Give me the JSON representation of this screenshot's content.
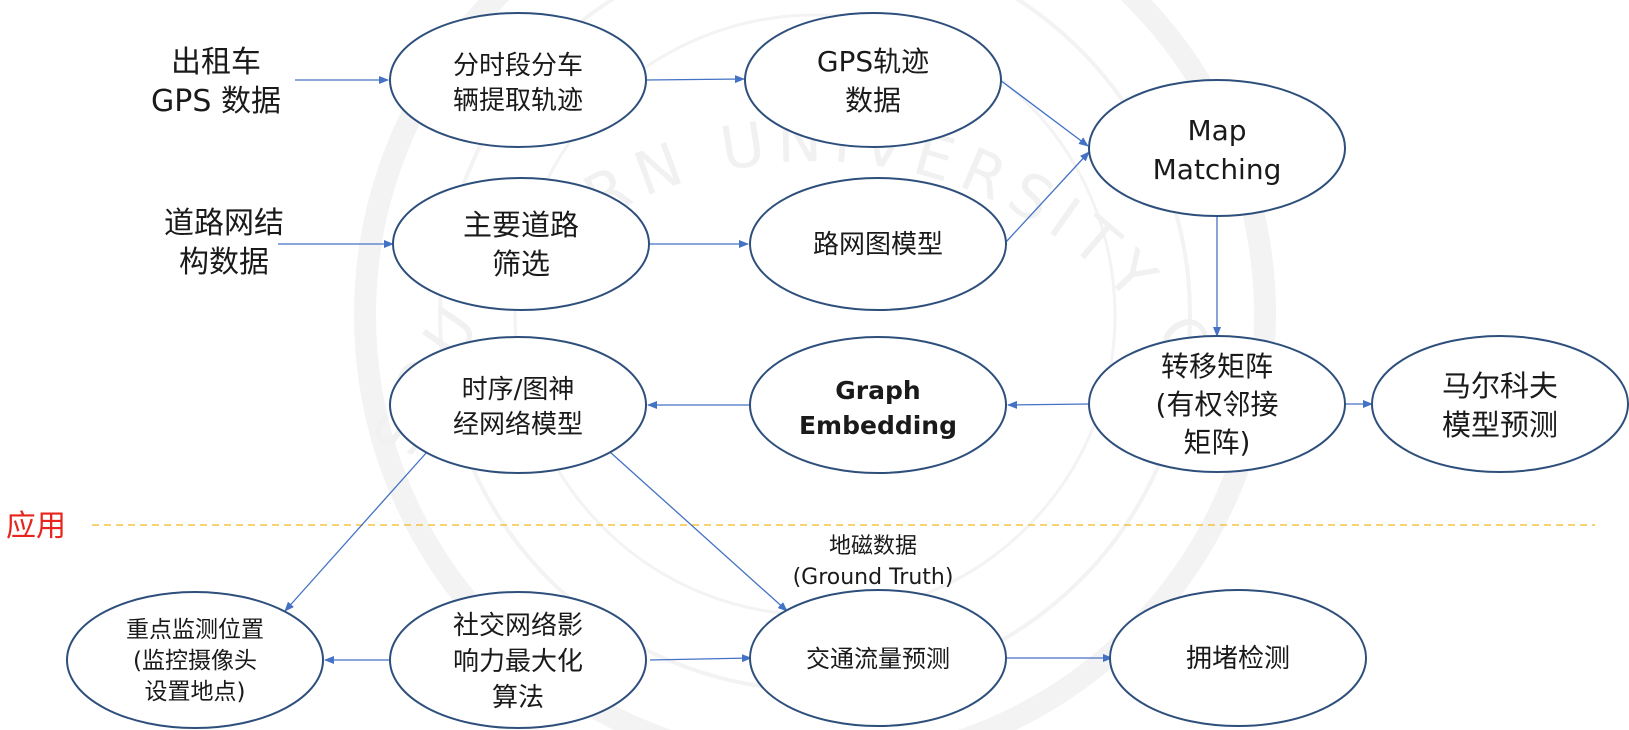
{
  "colors": {
    "arrow": "#4472c4",
    "ellipse_stroke": "#2e4f7c",
    "section_line": "#f5c242",
    "section_label": "#e8251c"
  },
  "watermark": {
    "text": "SOUTHERN UNIVERSITY OF SCIENCE AND TECHNOLOGY"
  },
  "section_label": "应用",
  "ground_truth_label": [
    "地磁数据",
    "(Ground Truth)"
  ],
  "sources": [
    {
      "id": "taxi_gps",
      "lines": [
        "出租车",
        "GPS 数据"
      ]
    },
    {
      "id": "road_data",
      "lines": [
        "道路网结",
        "构数据"
      ]
    }
  ],
  "nodes": [
    {
      "id": "split_traj",
      "lines": [
        "分时段分车",
        "辆提取轨迹"
      ],
      "bold": false
    },
    {
      "id": "gps_traj",
      "lines": [
        "GPS轨迹",
        "数据"
      ],
      "bold": false
    },
    {
      "id": "map_matching",
      "lines": [
        "Map",
        "Matching"
      ],
      "bold": false
    },
    {
      "id": "road_filter",
      "lines": [
        "主要道路",
        "筛选"
      ],
      "bold": false
    },
    {
      "id": "road_graph",
      "lines": [
        "路网图模型"
      ],
      "bold": false
    },
    {
      "id": "transfer_matrix",
      "lines": [
        "转移矩阵",
        "(有权邻接",
        "矩阵)"
      ],
      "bold": false
    },
    {
      "id": "markov",
      "lines": [
        "马尔科夫",
        "模型预测"
      ],
      "bold": false
    },
    {
      "id": "graph_embedding",
      "lines": [
        "Graph",
        "Embedding"
      ],
      "bold": true
    },
    {
      "id": "temporal_gnn",
      "lines": [
        "时序/图神",
        "经网络模型"
      ],
      "bold": false
    },
    {
      "id": "monitor_pos",
      "lines": [
        "重点监测位置",
        "(监控摄像头",
        "设置地点)"
      ],
      "bold": false
    },
    {
      "id": "influence_max",
      "lines": [
        "社交网络影",
        "响力最大化",
        "算法"
      ],
      "bold": false
    },
    {
      "id": "traffic_pred",
      "lines": [
        "交通流量预测"
      ],
      "bold": false
    },
    {
      "id": "congestion",
      "lines": [
        "拥堵检测"
      ],
      "bold": false
    }
  ]
}
